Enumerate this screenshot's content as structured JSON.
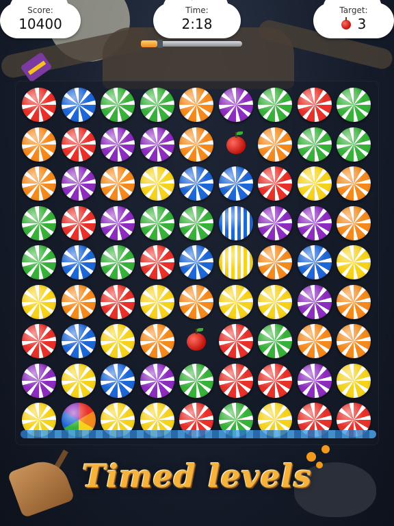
{
  "hud": {
    "score_label": "Score:",
    "score_value": "10400",
    "time_label": "Time:",
    "time_value": "2:18",
    "target_label": "Target:",
    "target_value": "3",
    "target_icon": "apple-icon",
    "time_remaining_fraction": 0.18
  },
  "banner_text": "Timed levels",
  "colors": {
    "red": "#e8312a",
    "blue": "#1e67d6",
    "green": "#38b13b",
    "orange": "#f48a1d",
    "purple": "#8d2dbf",
    "yellow": "#f5d21c"
  },
  "board": {
    "rows": 9,
    "cols": 9,
    "cells": [
      [
        "red",
        "blue",
        "green",
        "green",
        "orange",
        "purple",
        "green",
        "red",
        "green"
      ],
      [
        "orange",
        "red",
        "purple",
        "purple",
        "orange",
        "apple",
        "orange",
        "green",
        "green"
      ],
      [
        "orange",
        "purple",
        "orange",
        "yellow",
        "blue",
        "blue",
        "red",
        "yellow",
        "orange"
      ],
      [
        "green",
        "red",
        "purple",
        "green",
        "green",
        "striped-blue",
        "purple",
        "purple",
        "orange"
      ],
      [
        "green",
        "blue",
        "green",
        "red",
        "blue",
        "striped-yellow",
        "orange",
        "blue",
        "yellow"
      ],
      [
        "yellow",
        "orange",
        "red",
        "yellow",
        "orange",
        "yellow",
        "yellow",
        "purple",
        "orange"
      ],
      [
        "red",
        "blue",
        "yellow",
        "orange",
        "apple",
        "red",
        "green",
        "orange",
        "orange"
      ],
      [
        "purple",
        "yellow",
        "blue",
        "purple",
        "green",
        "red",
        "red",
        "purple",
        "yellow"
      ],
      [
        "yellow",
        "rainbow",
        "yellow",
        "yellow",
        "red",
        "green",
        "yellow",
        "red",
        "red"
      ]
    ]
  }
}
